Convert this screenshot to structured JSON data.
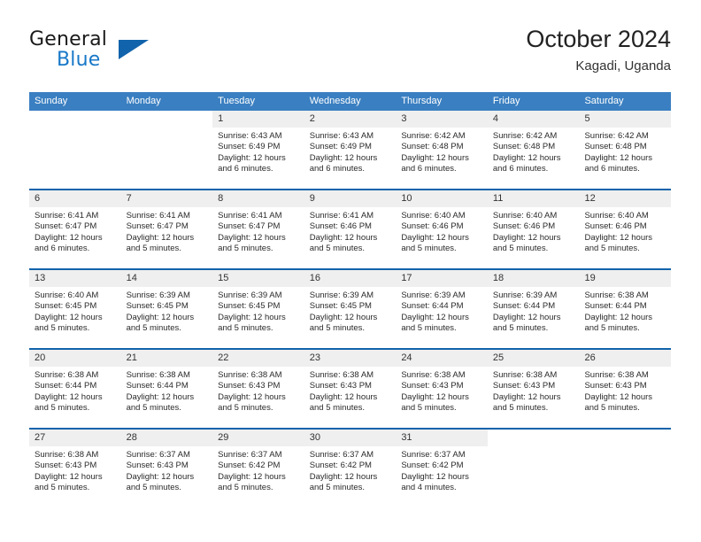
{
  "brand": {
    "name_part1": "General",
    "name_part2": "Blue",
    "triangle_color": "#1163ab",
    "blue_color": "#1878c8"
  },
  "header": {
    "title": "October 2024",
    "subtitle": "Kagadi, Uganda"
  },
  "theme": {
    "header_row_bg": "#3a7fc1",
    "week_separator": "#1163ab",
    "date_band_bg": "#efefef"
  },
  "weekdays": [
    "Sunday",
    "Monday",
    "Tuesday",
    "Wednesday",
    "Thursday",
    "Friday",
    "Saturday"
  ],
  "weeks": [
    [
      {
        "day": "",
        "sunrise": "",
        "sunset": "",
        "daylight1": "",
        "daylight2": "",
        "blank": true
      },
      {
        "day": "",
        "sunrise": "",
        "sunset": "",
        "daylight1": "",
        "daylight2": "",
        "blank": true
      },
      {
        "day": "1",
        "sunrise": "Sunrise: 6:43 AM",
        "sunset": "Sunset: 6:49 PM",
        "daylight1": "Daylight: 12 hours",
        "daylight2": "and 6 minutes."
      },
      {
        "day": "2",
        "sunrise": "Sunrise: 6:43 AM",
        "sunset": "Sunset: 6:49 PM",
        "daylight1": "Daylight: 12 hours",
        "daylight2": "and 6 minutes."
      },
      {
        "day": "3",
        "sunrise": "Sunrise: 6:42 AM",
        "sunset": "Sunset: 6:48 PM",
        "daylight1": "Daylight: 12 hours",
        "daylight2": "and 6 minutes."
      },
      {
        "day": "4",
        "sunrise": "Sunrise: 6:42 AM",
        "sunset": "Sunset: 6:48 PM",
        "daylight1": "Daylight: 12 hours",
        "daylight2": "and 6 minutes."
      },
      {
        "day": "5",
        "sunrise": "Sunrise: 6:42 AM",
        "sunset": "Sunset: 6:48 PM",
        "daylight1": "Daylight: 12 hours",
        "daylight2": "and 6 minutes."
      }
    ],
    [
      {
        "day": "6",
        "sunrise": "Sunrise: 6:41 AM",
        "sunset": "Sunset: 6:47 PM",
        "daylight1": "Daylight: 12 hours",
        "daylight2": "and 6 minutes."
      },
      {
        "day": "7",
        "sunrise": "Sunrise: 6:41 AM",
        "sunset": "Sunset: 6:47 PM",
        "daylight1": "Daylight: 12 hours",
        "daylight2": "and 5 minutes."
      },
      {
        "day": "8",
        "sunrise": "Sunrise: 6:41 AM",
        "sunset": "Sunset: 6:47 PM",
        "daylight1": "Daylight: 12 hours",
        "daylight2": "and 5 minutes."
      },
      {
        "day": "9",
        "sunrise": "Sunrise: 6:41 AM",
        "sunset": "Sunset: 6:46 PM",
        "daylight1": "Daylight: 12 hours",
        "daylight2": "and 5 minutes."
      },
      {
        "day": "10",
        "sunrise": "Sunrise: 6:40 AM",
        "sunset": "Sunset: 6:46 PM",
        "daylight1": "Daylight: 12 hours",
        "daylight2": "and 5 minutes."
      },
      {
        "day": "11",
        "sunrise": "Sunrise: 6:40 AM",
        "sunset": "Sunset: 6:46 PM",
        "daylight1": "Daylight: 12 hours",
        "daylight2": "and 5 minutes."
      },
      {
        "day": "12",
        "sunrise": "Sunrise: 6:40 AM",
        "sunset": "Sunset: 6:46 PM",
        "daylight1": "Daylight: 12 hours",
        "daylight2": "and 5 minutes."
      }
    ],
    [
      {
        "day": "13",
        "sunrise": "Sunrise: 6:40 AM",
        "sunset": "Sunset: 6:45 PM",
        "daylight1": "Daylight: 12 hours",
        "daylight2": "and 5 minutes."
      },
      {
        "day": "14",
        "sunrise": "Sunrise: 6:39 AM",
        "sunset": "Sunset: 6:45 PM",
        "daylight1": "Daylight: 12 hours",
        "daylight2": "and 5 minutes."
      },
      {
        "day": "15",
        "sunrise": "Sunrise: 6:39 AM",
        "sunset": "Sunset: 6:45 PM",
        "daylight1": "Daylight: 12 hours",
        "daylight2": "and 5 minutes."
      },
      {
        "day": "16",
        "sunrise": "Sunrise: 6:39 AM",
        "sunset": "Sunset: 6:45 PM",
        "daylight1": "Daylight: 12 hours",
        "daylight2": "and 5 minutes."
      },
      {
        "day": "17",
        "sunrise": "Sunrise: 6:39 AM",
        "sunset": "Sunset: 6:44 PM",
        "daylight1": "Daylight: 12 hours",
        "daylight2": "and 5 minutes."
      },
      {
        "day": "18",
        "sunrise": "Sunrise: 6:39 AM",
        "sunset": "Sunset: 6:44 PM",
        "daylight1": "Daylight: 12 hours",
        "daylight2": "and 5 minutes."
      },
      {
        "day": "19",
        "sunrise": "Sunrise: 6:38 AM",
        "sunset": "Sunset: 6:44 PM",
        "daylight1": "Daylight: 12 hours",
        "daylight2": "and 5 minutes."
      }
    ],
    [
      {
        "day": "20",
        "sunrise": "Sunrise: 6:38 AM",
        "sunset": "Sunset: 6:44 PM",
        "daylight1": "Daylight: 12 hours",
        "daylight2": "and 5 minutes."
      },
      {
        "day": "21",
        "sunrise": "Sunrise: 6:38 AM",
        "sunset": "Sunset: 6:44 PM",
        "daylight1": "Daylight: 12 hours",
        "daylight2": "and 5 minutes."
      },
      {
        "day": "22",
        "sunrise": "Sunrise: 6:38 AM",
        "sunset": "Sunset: 6:43 PM",
        "daylight1": "Daylight: 12 hours",
        "daylight2": "and 5 minutes."
      },
      {
        "day": "23",
        "sunrise": "Sunrise: 6:38 AM",
        "sunset": "Sunset: 6:43 PM",
        "daylight1": "Daylight: 12 hours",
        "daylight2": "and 5 minutes."
      },
      {
        "day": "24",
        "sunrise": "Sunrise: 6:38 AM",
        "sunset": "Sunset: 6:43 PM",
        "daylight1": "Daylight: 12 hours",
        "daylight2": "and 5 minutes."
      },
      {
        "day": "25",
        "sunrise": "Sunrise: 6:38 AM",
        "sunset": "Sunset: 6:43 PM",
        "daylight1": "Daylight: 12 hours",
        "daylight2": "and 5 minutes."
      },
      {
        "day": "26",
        "sunrise": "Sunrise: 6:38 AM",
        "sunset": "Sunset: 6:43 PM",
        "daylight1": "Daylight: 12 hours",
        "daylight2": "and 5 minutes."
      }
    ],
    [
      {
        "day": "27",
        "sunrise": "Sunrise: 6:38 AM",
        "sunset": "Sunset: 6:43 PM",
        "daylight1": "Daylight: 12 hours",
        "daylight2": "and 5 minutes."
      },
      {
        "day": "28",
        "sunrise": "Sunrise: 6:37 AM",
        "sunset": "Sunset: 6:43 PM",
        "daylight1": "Daylight: 12 hours",
        "daylight2": "and 5 minutes."
      },
      {
        "day": "29",
        "sunrise": "Sunrise: 6:37 AM",
        "sunset": "Sunset: 6:42 PM",
        "daylight1": "Daylight: 12 hours",
        "daylight2": "and 5 minutes."
      },
      {
        "day": "30",
        "sunrise": "Sunrise: 6:37 AM",
        "sunset": "Sunset: 6:42 PM",
        "daylight1": "Daylight: 12 hours",
        "daylight2": "and 5 minutes."
      },
      {
        "day": "31",
        "sunrise": "Sunrise: 6:37 AM",
        "sunset": "Sunset: 6:42 PM",
        "daylight1": "Daylight: 12 hours",
        "daylight2": "and 4 minutes."
      },
      {
        "day": "",
        "sunrise": "",
        "sunset": "",
        "daylight1": "",
        "daylight2": "",
        "blank": true
      },
      {
        "day": "",
        "sunrise": "",
        "sunset": "",
        "daylight1": "",
        "daylight2": "",
        "blank": true
      }
    ]
  ]
}
